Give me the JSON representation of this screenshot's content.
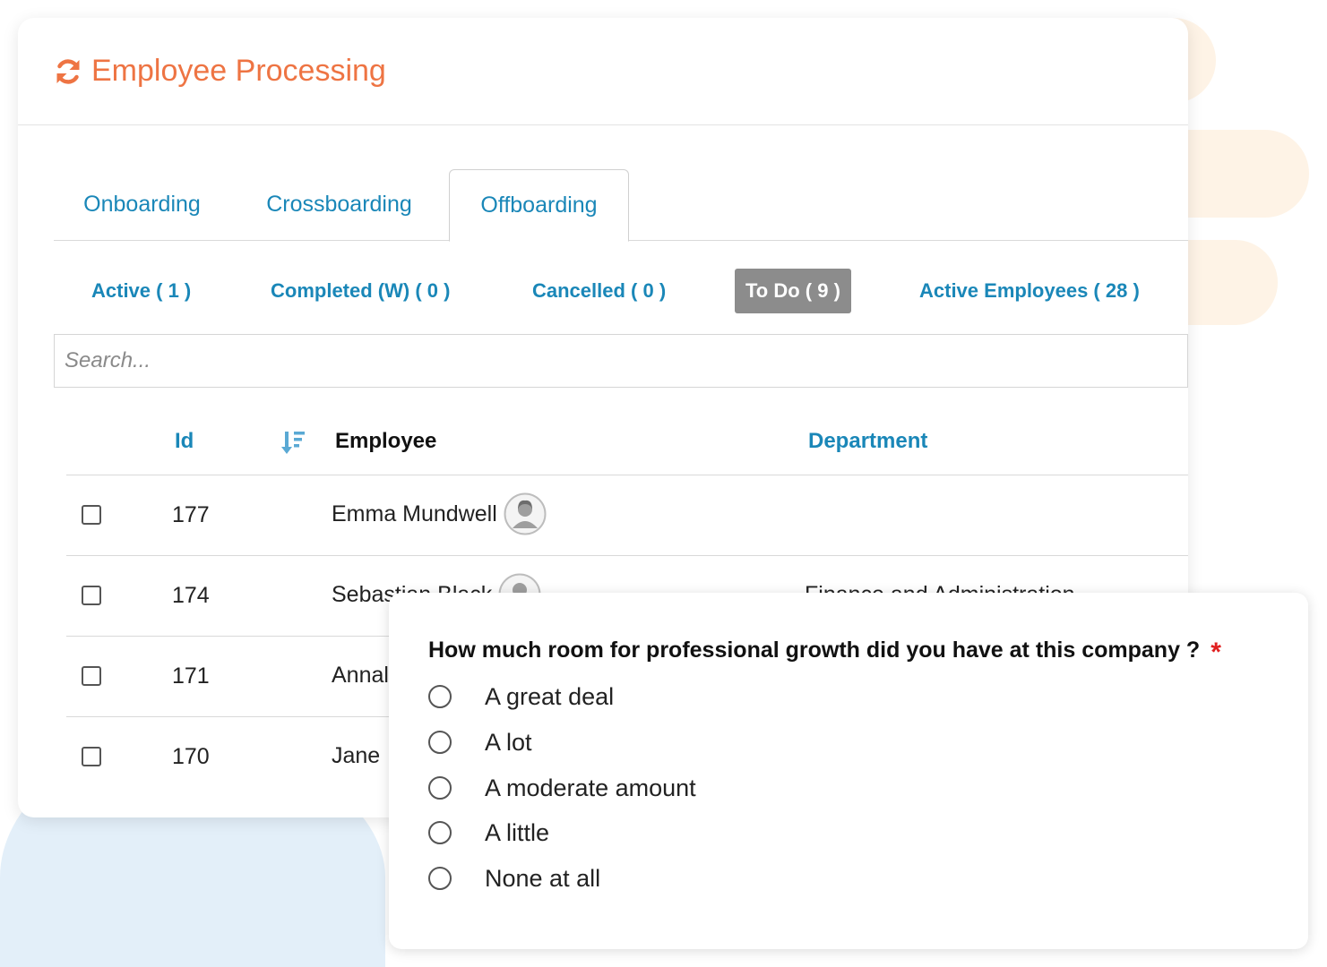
{
  "app": {
    "title": "Employee Processing"
  },
  "tabs": [
    {
      "label": "Onboarding"
    },
    {
      "label": "Crossboarding"
    },
    {
      "label": "Offboarding",
      "active": true
    }
  ],
  "filters": {
    "active": "Active ( 1 )",
    "completed": "Completed (W) ( 0 )",
    "cancelled": "Cancelled ( 0 )",
    "todo": "To Do ( 9 )",
    "active_employees": "Active Employees ( 28 )"
  },
  "search": {
    "placeholder": "Search..."
  },
  "table": {
    "columns": {
      "id": "Id",
      "employee": "Employee",
      "department": "Department"
    },
    "rows": [
      {
        "id": "177",
        "name": "Emma Mundwell",
        "department": ""
      },
      {
        "id": "174",
        "name": "Sebastian Black",
        "department": "Finance and Administration"
      },
      {
        "id": "171",
        "name": "Annal",
        "department": ""
      },
      {
        "id": "170",
        "name": "Jane",
        "department": ""
      }
    ]
  },
  "survey": {
    "question": "How much room for professional growth did you have at this company ?",
    "required_mark": "*",
    "options": [
      "A great deal",
      "A lot",
      "A moderate amount",
      "A little",
      "None at all"
    ]
  },
  "colors": {
    "brand": "#ee7443",
    "link": "#1a87b8",
    "badge": "#8c8c8c",
    "required": "#e02020"
  },
  "icons": {
    "title": "refresh-icon",
    "sort": "sort-desc-icon",
    "avatar": "user-avatar-icon"
  }
}
